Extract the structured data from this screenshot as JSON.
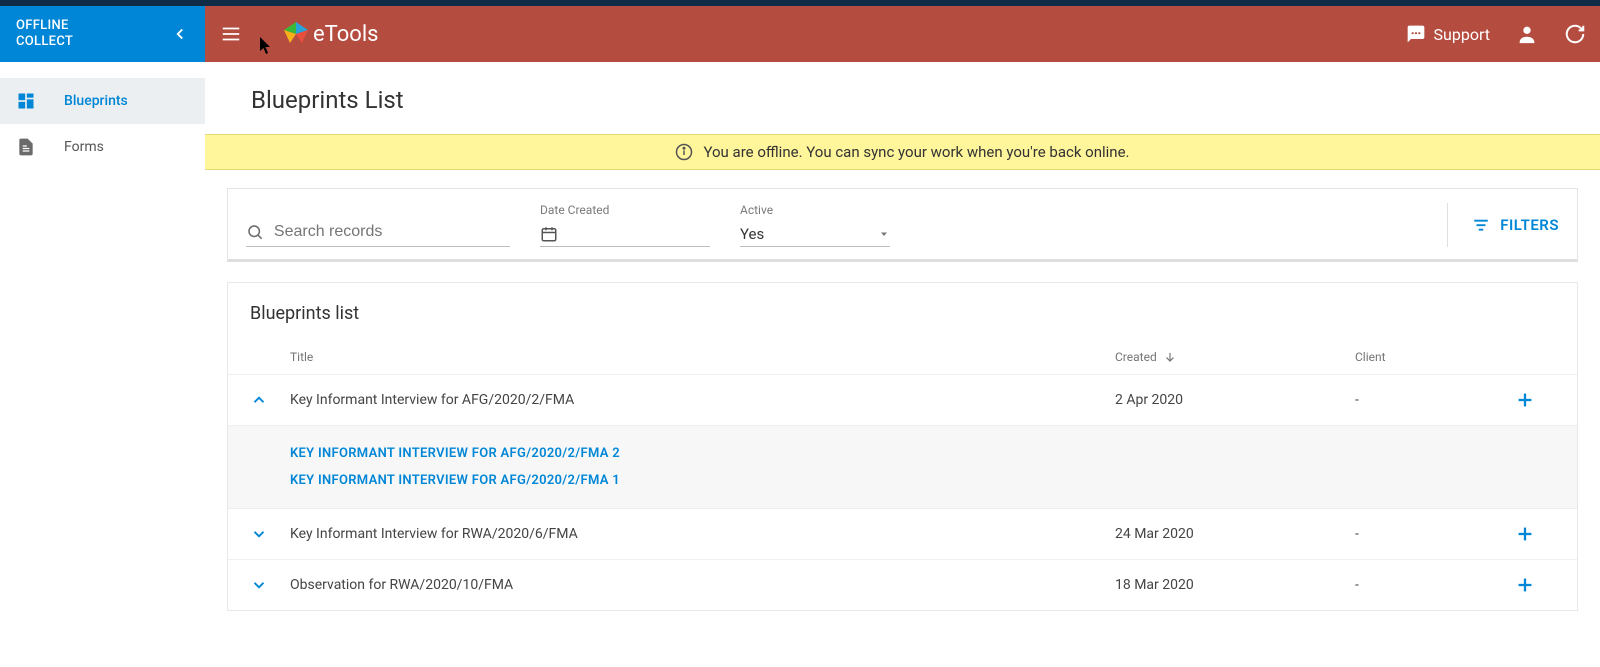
{
  "sidebar": {
    "app_line1": "OFFLINE",
    "app_line2": "COLLECT",
    "items": [
      {
        "label": "Blueprints"
      },
      {
        "label": "Forms"
      }
    ]
  },
  "header": {
    "brand": "eTools",
    "support": "Support"
  },
  "page": {
    "title": "Blueprints List",
    "banner": "You are offline. You can sync your work when you're back online."
  },
  "filters": {
    "search_placeholder": "Search records",
    "date_label": "Date Created",
    "active_label": "Active",
    "active_value": "Yes",
    "filters_button": "FILTERS"
  },
  "list": {
    "section_title": "Blueprints list",
    "columns": {
      "title": "Title",
      "created": "Created",
      "client": "Client"
    },
    "rows": [
      {
        "expanded": true,
        "title": "Key Informant Interview for AFG/2020/2/FMA",
        "created": "2 Apr 2020",
        "client": "-",
        "children": [
          "KEY INFORMANT INTERVIEW FOR AFG/2020/2/FMA 2",
          "KEY INFORMANT INTERVIEW FOR AFG/2020/2/FMA 1"
        ]
      },
      {
        "expanded": false,
        "title": "Key Informant Interview for RWA/2020/6/FMA",
        "created": "24 Mar 2020",
        "client": "-"
      },
      {
        "expanded": false,
        "title": "Observation for RWA/2020/10/FMA",
        "created": "18 Mar 2020",
        "client": "-"
      }
    ]
  }
}
